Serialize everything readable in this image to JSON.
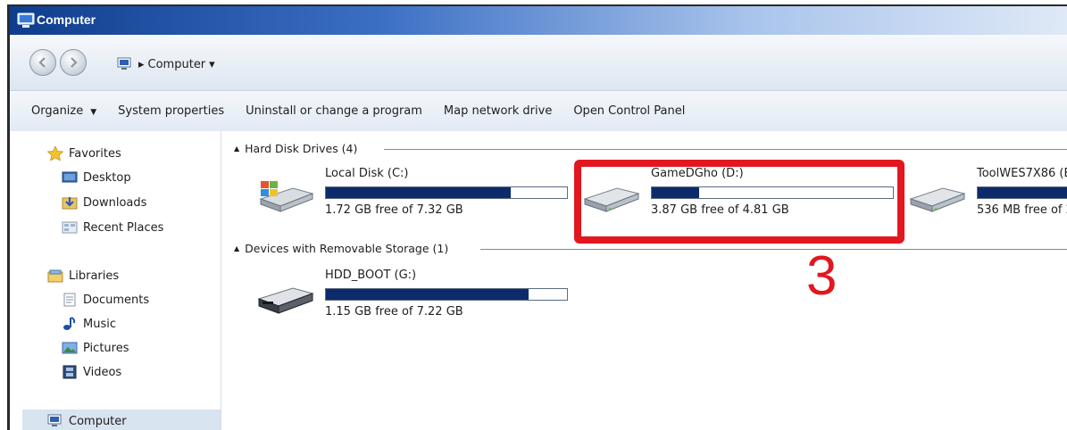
{
  "window": {
    "title": "Computer",
    "title_icon": "computer-icon"
  },
  "address": {
    "location_icon": "computer-icon",
    "separator": "▸",
    "path": "Computer",
    "dropdown": "▾"
  },
  "commands": {
    "organize": "Organize",
    "system_properties": "System properties",
    "uninstall": "Uninstall or change a program",
    "map_drive": "Map network drive",
    "control_panel": "Open Control Panel"
  },
  "navpane": {
    "favorites": {
      "label": "Favorites",
      "icon": "star-icon",
      "items": [
        {
          "label": "Desktop",
          "icon": "desktop-icon"
        },
        {
          "label": "Downloads",
          "icon": "downloads-icon"
        },
        {
          "label": "Recent Places",
          "icon": "recent-places-icon"
        }
      ]
    },
    "libraries": {
      "label": "Libraries",
      "icon": "libraries-icon",
      "items": [
        {
          "label": "Documents",
          "icon": "documents-icon"
        },
        {
          "label": "Music",
          "icon": "music-icon"
        },
        {
          "label": "Pictures",
          "icon": "pictures-icon"
        },
        {
          "label": "Videos",
          "icon": "videos-icon"
        }
      ]
    },
    "computer": {
      "label": "Computer",
      "icon": "computer-icon",
      "selected": true
    }
  },
  "groups": {
    "hdd": {
      "label": "Hard Disk Drives (4)"
    },
    "removable": {
      "label": "Devices with Removable Storage (1)"
    }
  },
  "drives": [
    {
      "name": "Local Disk (C:)",
      "free_text": "1.72 GB free of 7.32 GB",
      "used_fraction": 0.765,
      "icon": "windows-drive-icon"
    },
    {
      "name": "GameDGho (D:)",
      "free_text": "3.87 GB free of 4.81 GB",
      "used_fraction": 0.196,
      "icon": "hard-drive-icon"
    },
    {
      "name": "ToolWES7X86 (E",
      "free_text": "536 MB free of 2",
      "used_fraction": 0.8,
      "icon": "hard-drive-icon"
    },
    {
      "name": "HDD_BOOT (G:)",
      "free_text": "1.15 GB free of 7.22 GB",
      "used_fraction": 0.841,
      "icon": "removable-drive-icon"
    }
  ],
  "annotation": {
    "number": "3",
    "color": "#e2171f"
  },
  "colors": {
    "bar_fill": "#0d2b6a",
    "selection": "#d9e4f1"
  }
}
